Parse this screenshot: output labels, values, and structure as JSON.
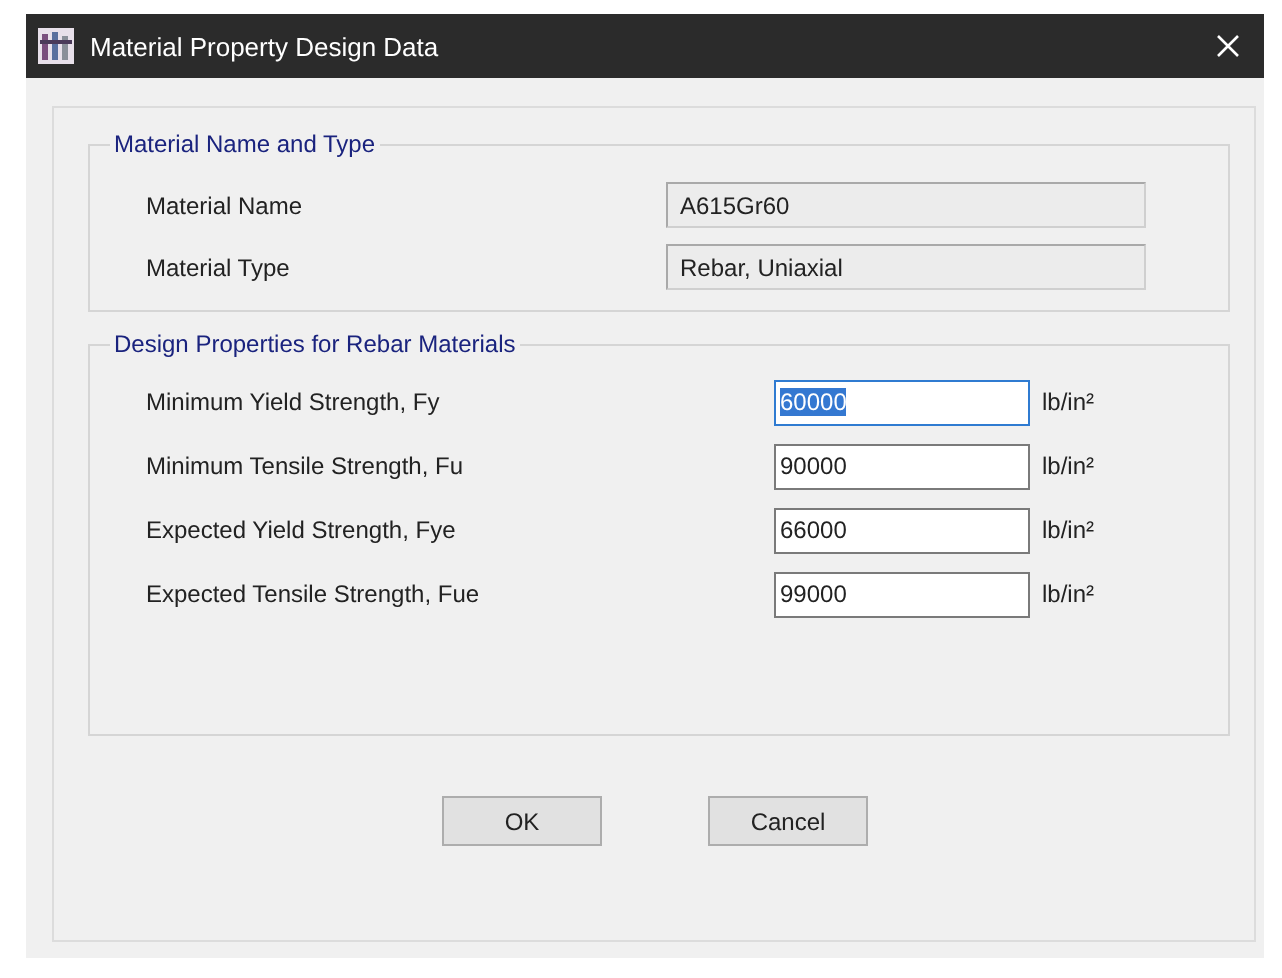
{
  "window": {
    "title": "Material Property Design Data"
  },
  "groups": [
    {
      "title": "Material Name and Type",
      "kind": "readonly",
      "rows": [
        {
          "label": "Material Name",
          "value": "A615Gr60"
        },
        {
          "label": "Material Type",
          "value": "Rebar, Uniaxial"
        }
      ]
    },
    {
      "title": "Design Properties for Rebar Materials",
      "kind": "editable",
      "rows": [
        {
          "label": "Minimum Yield Strength, Fy",
          "value": "60000",
          "unit": "lb/in²",
          "selected": true
        },
        {
          "label": "Minimum Tensile Strength, Fu",
          "value": "90000",
          "unit": "lb/in²",
          "selected": false
        },
        {
          "label": "Expected Yield Strength, Fye",
          "value": "66000",
          "unit": "lb/in²",
          "selected": false
        },
        {
          "label": "Expected Tensile Strength, Fue",
          "value": "99000",
          "unit": "lb/in²",
          "selected": false
        }
      ]
    }
  ],
  "buttons": [
    "OK",
    "Cancel"
  ]
}
